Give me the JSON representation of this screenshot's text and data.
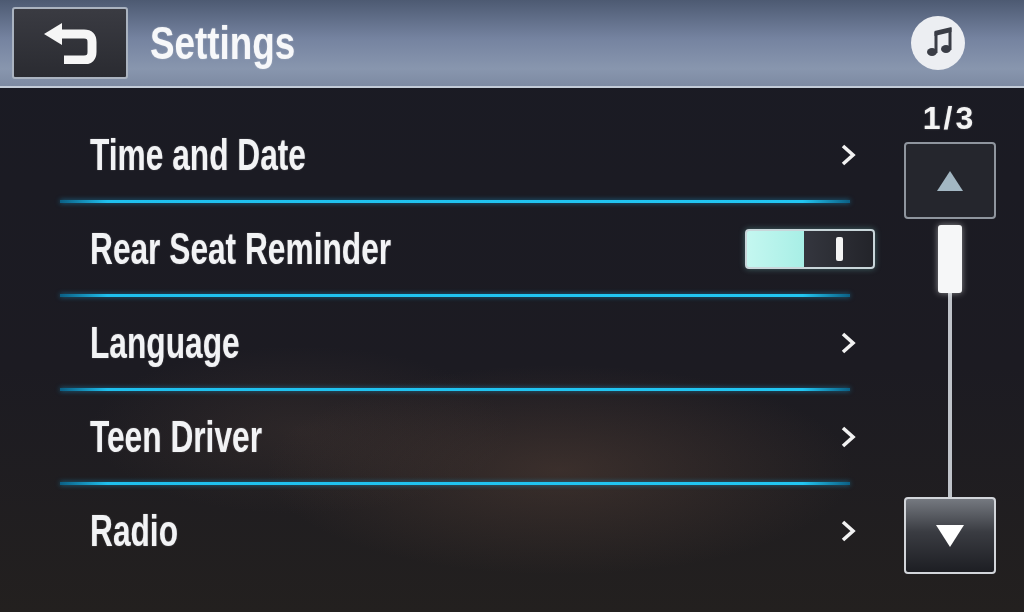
{
  "header": {
    "title": "Settings"
  },
  "settings": [
    {
      "kind": "link",
      "label": "Time and Date"
    },
    {
      "kind": "toggle",
      "label": "Rear Seat Reminder",
      "on": true
    },
    {
      "kind": "link",
      "label": "Language"
    },
    {
      "kind": "link",
      "label": "Teen Driver"
    },
    {
      "kind": "link",
      "label": "Radio"
    }
  ],
  "pager": {
    "page_label": "1/3",
    "scroll_up": {
      "disabled": true
    },
    "scroll_down": {
      "disabled": false
    }
  }
}
